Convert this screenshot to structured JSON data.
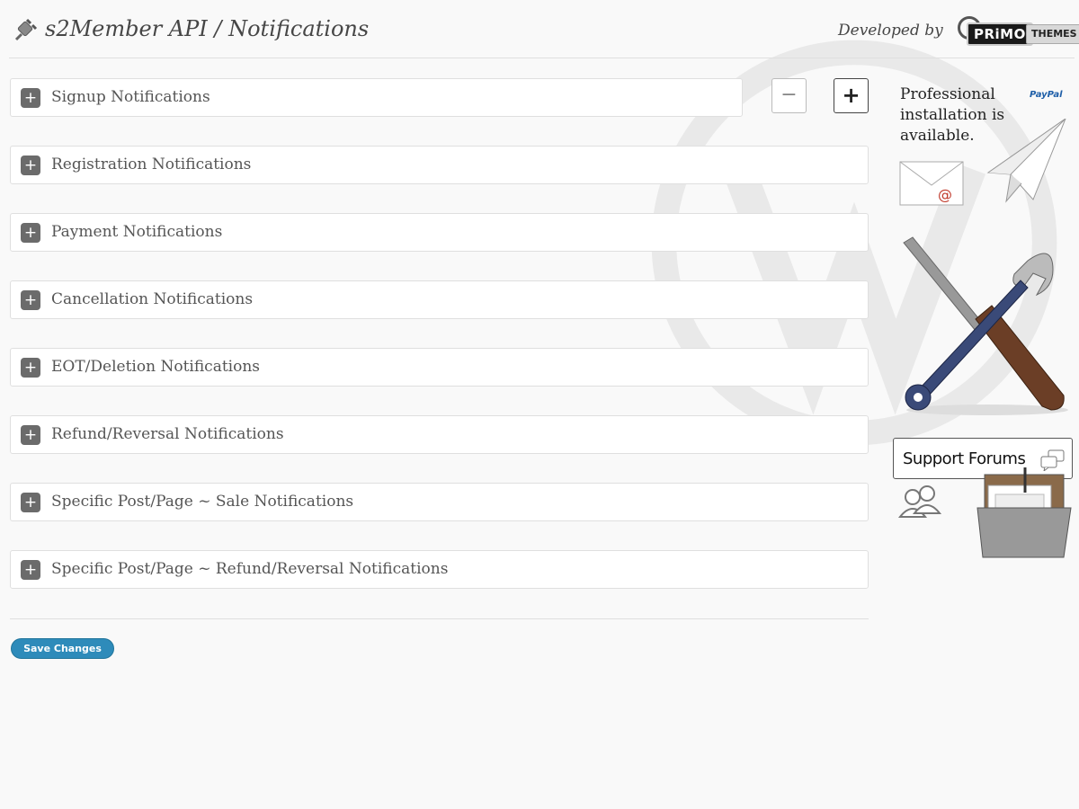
{
  "header": {
    "title": "s2Member API / Notifications",
    "developed_by": "Developed by",
    "logo_primo": "PRiMO",
    "logo_themes": "THEMES"
  },
  "panels": [
    {
      "label": "Signup Notifications",
      "icon": "plus-icon",
      "toggle": "+"
    },
    {
      "label": "Registration Notifications",
      "icon": "plus-icon",
      "toggle": "+"
    },
    {
      "label": "Payment Notifications",
      "icon": "plus-icon",
      "toggle": "+"
    },
    {
      "label": "Cancellation Notifications",
      "icon": "plus-icon",
      "toggle": "+"
    },
    {
      "label": "EOT/Deletion Notifications",
      "icon": "plus-icon",
      "toggle": "+"
    },
    {
      "label": "Refund/Reversal Notifications",
      "icon": "plus-icon",
      "toggle": "+"
    },
    {
      "label": "Specific Post/Page ~ Sale Notifications",
      "icon": "plus-icon",
      "toggle": "+"
    },
    {
      "label": "Specific Post/Page ~ Refund/Reversal Notifications",
      "icon": "plus-icon",
      "toggle": "+"
    }
  ],
  "controls": {
    "collapse_all": "−",
    "expand_all": "+"
  },
  "save_button": "Save Changes",
  "sidebar": {
    "installation_text": "Professional installation is available.",
    "paypal_label": "PayPal",
    "support_forums": "Support Forums"
  },
  "colors": {
    "accent": "#2e8bba",
    "background": "#f9f9f9",
    "panel_border": "#dfdfdf",
    "toggle_bg": "#6b6b6b"
  }
}
